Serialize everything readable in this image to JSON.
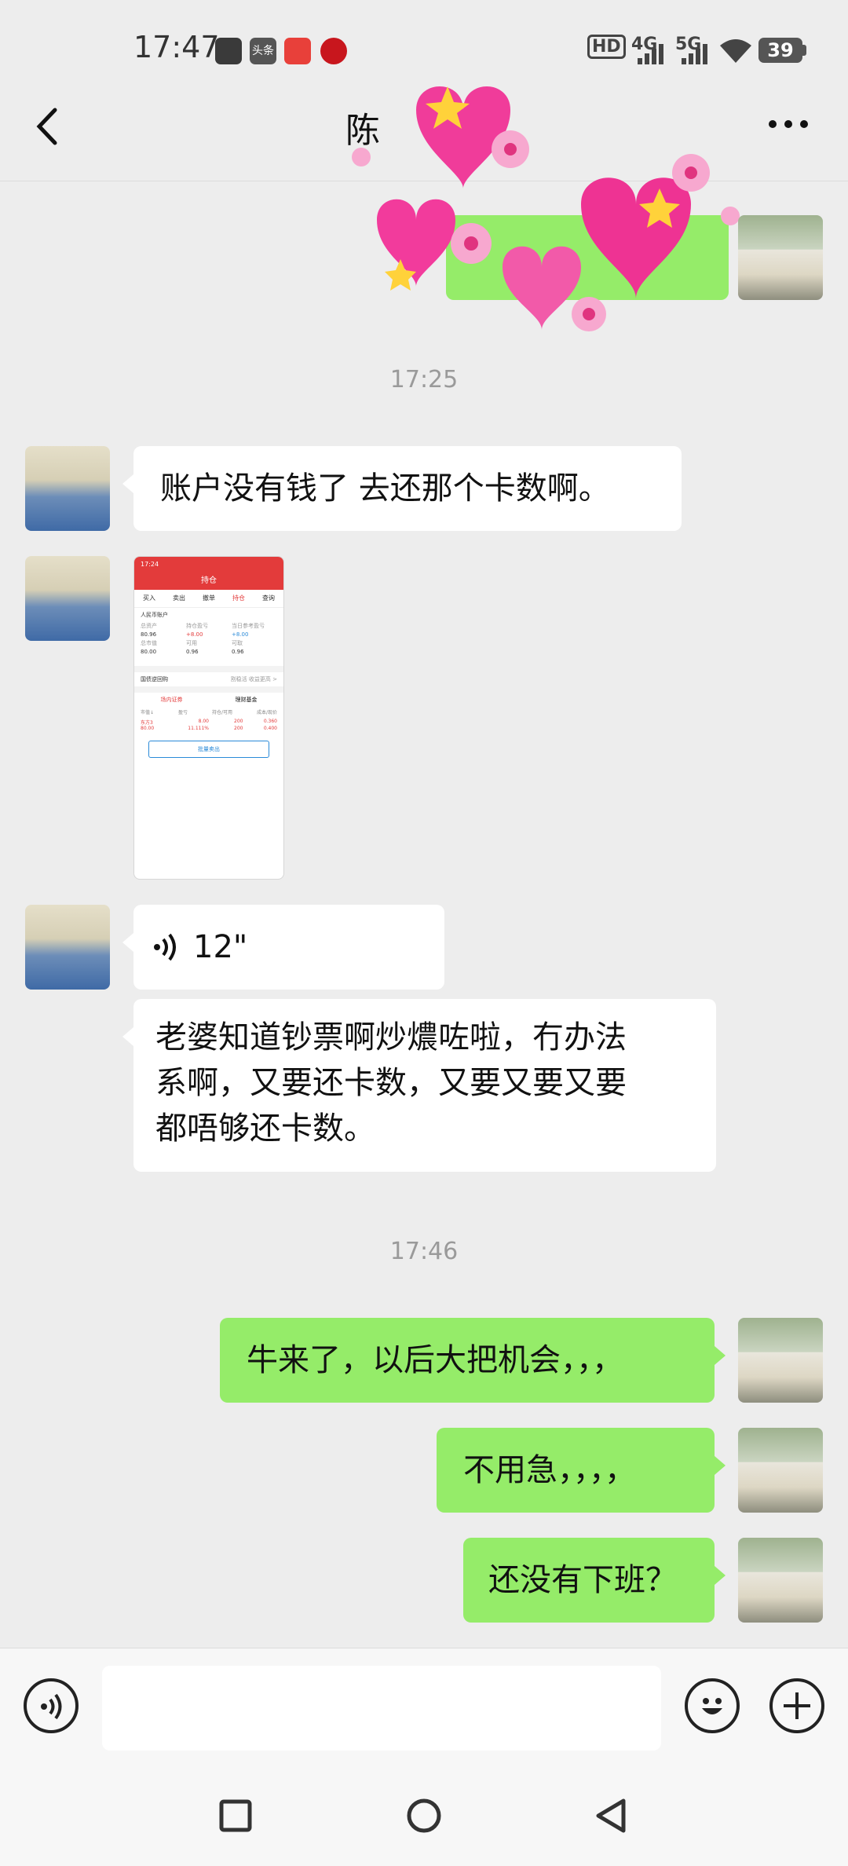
{
  "status_bar": {
    "time": "17:47",
    "notification_icons": [
      "wechat-icon",
      "toutiao-icon",
      "news-app-icon",
      "bank-app-icon"
    ],
    "network": {
      "hd": "HD",
      "sim1": "4G",
      "sim2": "5G"
    },
    "battery": "39"
  },
  "header": {
    "back_icon": "chevron-left-icon",
    "title": "陈",
    "more_icon": "more-dots-icon"
  },
  "messages": [
    {
      "type": "sticker",
      "side": "out",
      "description": "pink hearts and flowers sticker"
    },
    {
      "type": "timestamp",
      "text": "17:25"
    },
    {
      "type": "text",
      "side": "in",
      "text": "账户没有钱了 去还那个卡数啊。"
    },
    {
      "type": "image",
      "side": "in"
    },
    {
      "type": "voice",
      "side": "in",
      "duration": "12\""
    },
    {
      "type": "text",
      "side": "in",
      "lines": [
        "老婆知道钞票啊炒燶咗啦，冇办法",
        "系啊，又要还卡数，又要又要又要",
        "都唔够还卡数。"
      ]
    },
    {
      "type": "timestamp",
      "text": "17:46"
    },
    {
      "type": "text",
      "side": "out",
      "text": "牛来了，以后大把机会，，，"
    },
    {
      "type": "text",
      "side": "out",
      "text": "不用急，，，，"
    },
    {
      "type": "text",
      "side": "out",
      "text": "还没有下班？"
    }
  ],
  "screenshot_thumb": {
    "time": "17:24",
    "title": "持仓",
    "tabs": [
      "买入",
      "卖出",
      "撤单",
      "持仓",
      "查询"
    ],
    "account": "人民币账户",
    "stats": [
      {
        "label": "总资产",
        "value": "80.96"
      },
      {
        "label": "持仓盈亏",
        "value": "+8.00"
      },
      {
        "label": "当日参考盈亏",
        "value": "+8.00"
      },
      {
        "label": "总市值",
        "value": "80.00"
      },
      {
        "label": "可用",
        "value": "0.96"
      },
      {
        "label": "可取",
        "value": "0.96"
      }
    ],
    "section": "国债逆回购",
    "section_link": "割稳活 收益更高 >",
    "sub_tabs": [
      "场内证券",
      "理财基金"
    ],
    "columns": [
      "市值↓",
      "盈亏",
      "持仓/可用",
      "成本/现价"
    ],
    "row": {
      "name": "东方3",
      "value": "80.00",
      "pnl": "8.00",
      "pct": "11.111%",
      "hold": "200",
      "avail": "200",
      "cost": "0.360",
      "price": "0.400"
    },
    "button": "批量卖出"
  },
  "input_bar": {
    "voice_icon": "voice-mode-icon",
    "emoji_icon": "emoji-icon",
    "plus_icon": "plus-icon"
  },
  "nav_bar": [
    "square-recent-icon",
    "circle-home-icon",
    "triangle-back-icon"
  ]
}
